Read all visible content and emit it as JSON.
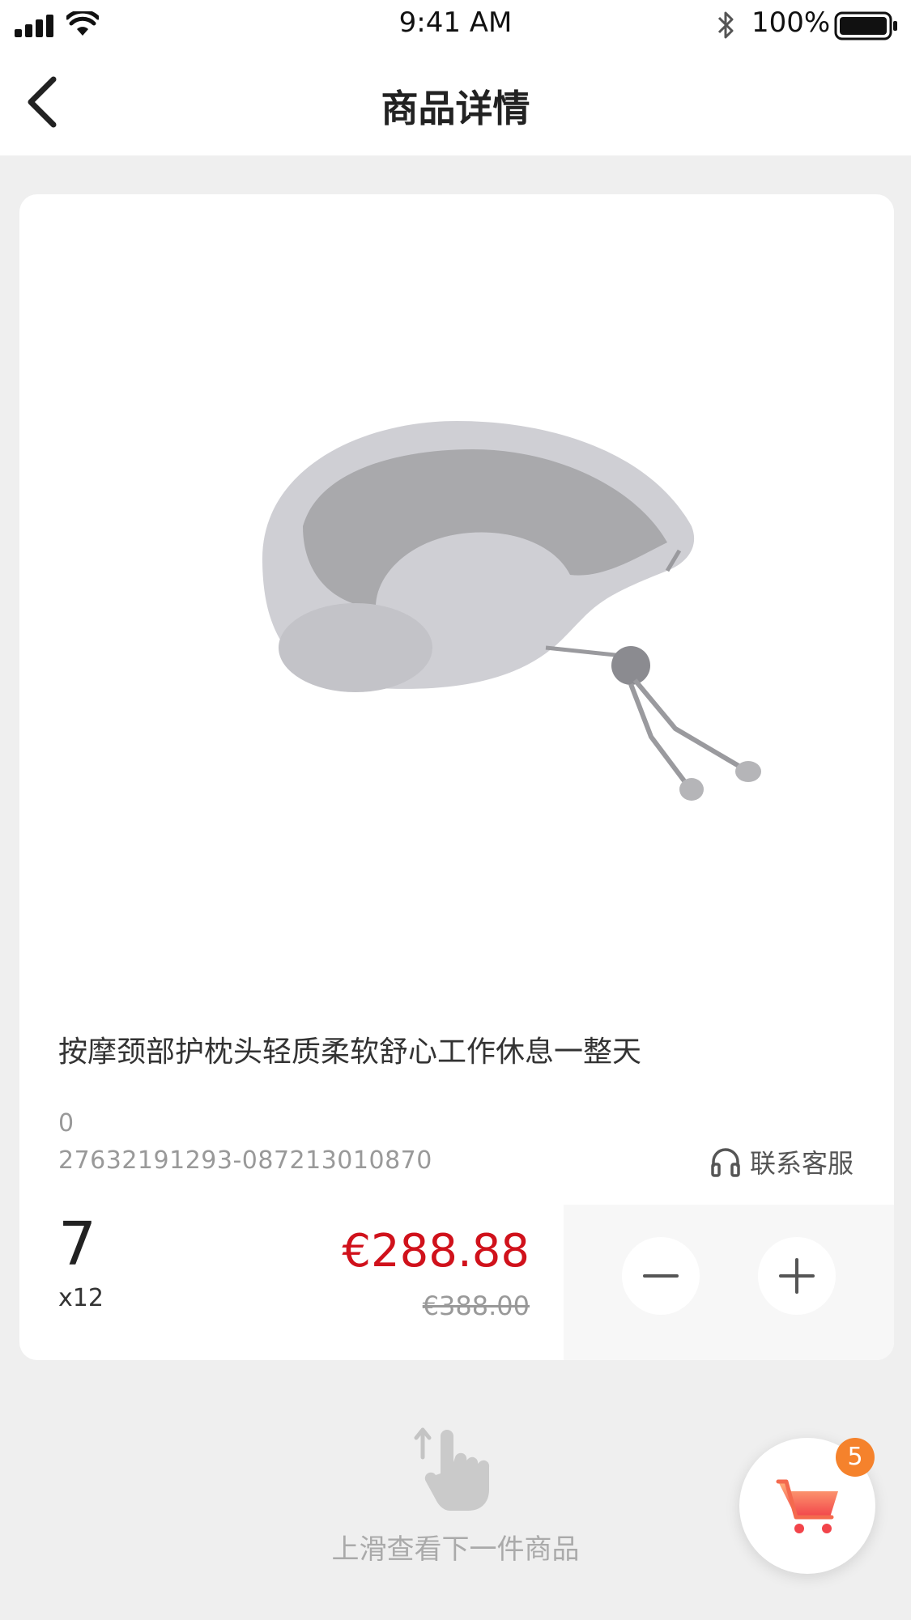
{
  "status_bar": {
    "time": "9:41 AM",
    "battery_percent": "100%",
    "icons": [
      "cellular-signal-icon",
      "wifi-icon",
      "bluetooth-icon",
      "battery-icon"
    ]
  },
  "nav": {
    "title": "商品详情",
    "back_icon": "chevron-left-icon"
  },
  "product": {
    "title": "按摩颈部护枕头轻质柔软舒心工作休息一整天",
    "meta_small": "0",
    "code": "27632191293-087213010870",
    "service_label": "联系客服",
    "stock_number": "7",
    "multiplier": "x12",
    "price": "€288.88",
    "original_price": "€388.00"
  },
  "quantity": {
    "minus_icon": "minus-icon",
    "plus_icon": "plus-icon"
  },
  "hint": {
    "text": "上滑查看下一件商品",
    "icon": "swipe-up-hand-icon"
  },
  "cart": {
    "badge_count": "5",
    "icon": "shopping-cart-icon"
  },
  "colors": {
    "price_red": "#d0111b",
    "cart_orange": "#f5822c",
    "cart_gradient_start": "#ffb07a",
    "cart_gradient_end": "#f2444a"
  }
}
